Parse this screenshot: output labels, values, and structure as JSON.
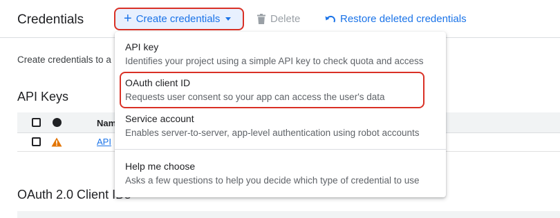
{
  "header": {
    "title": "Credentials",
    "create_label": "Create credentials",
    "delete_label": "Delete",
    "restore_label": "Restore deleted credentials"
  },
  "main": {
    "intro_text": "Create credentials to a",
    "api_keys_title": "API Keys",
    "name_col_label": "Nam",
    "api_row_link": "API",
    "oauth_title": "OAuth 2.0 Client IDs"
  },
  "menu": {
    "items": [
      {
        "title": "API key",
        "desc": "Identifies your project using a simple API key to check quota and access"
      },
      {
        "title": "OAuth client ID",
        "desc": "Requests user consent so your app can access the user's data"
      },
      {
        "title": "Service account",
        "desc": "Enables server-to-server, app-level authentication using robot accounts"
      },
      {
        "title": "Help me choose",
        "desc": "Asks a few questions to help you decide which type of credential to use"
      }
    ]
  },
  "colors": {
    "accent": "#1a73e8",
    "highlight": "#d93025",
    "warning": "#e37400"
  },
  "icons": [
    "plus-icon",
    "caret-down-icon",
    "trash-icon",
    "restore-icon",
    "warning-icon"
  ]
}
